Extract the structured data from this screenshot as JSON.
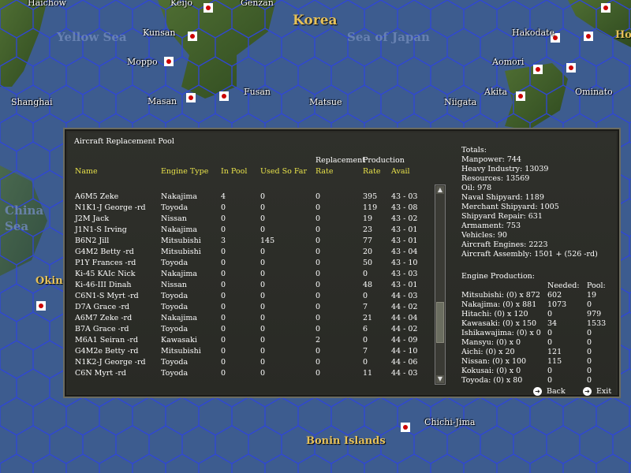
{
  "map": {
    "labels": [
      {
        "name": "map-label-haichow",
        "text": "Haichow"
      },
      {
        "name": "map-label-keijo",
        "text": "Keijo"
      },
      {
        "name": "map-label-genzan",
        "text": "Genzan"
      },
      {
        "name": "map-label-kunsan",
        "text": "Kunsan"
      },
      {
        "name": "map-label-moppo",
        "text": "Moppo"
      },
      {
        "name": "map-label-masan",
        "text": "Masan"
      },
      {
        "name": "map-label-fusan",
        "text": "Fusan"
      },
      {
        "name": "map-label-matsue",
        "text": "Matsue"
      },
      {
        "name": "map-label-niigata",
        "text": "Niigata"
      },
      {
        "name": "map-label-akita",
        "text": "Akita"
      },
      {
        "name": "map-label-aomori",
        "text": "Aomori"
      },
      {
        "name": "map-label-hakodate",
        "text": "Hakodate"
      },
      {
        "name": "map-label-ominato",
        "text": "Ominato"
      },
      {
        "name": "map-label-shanghai",
        "text": "Shanghai"
      },
      {
        "name": "map-label-chichi-jima",
        "text": "Chichi-Jima"
      }
    ],
    "seas": {
      "yellow_sea": "Yellow Sea",
      "sea_of_japan": "Sea of Japan",
      "china_sea_1": "China",
      "china_sea_2": "Sea"
    },
    "regions": {
      "korea": "Korea",
      "bonin": "Bonin Islands",
      "okin": "Okin",
      "ho": "Ho"
    }
  },
  "panel": {
    "title": "Aircraft Replacement Pool",
    "headers": {
      "name": "Name",
      "engine_type": "Engine Type",
      "in_pool": "In Pool",
      "used_so_far": "Used So Far",
      "replacement_top": "Replacement",
      "replacement_bottom": "Rate",
      "production_top": "Production",
      "production_bottom": "Rate",
      "avail": "Avail"
    },
    "rows": [
      {
        "name": "A6M5 Zeke",
        "engine": "Nakajima",
        "in_pool": "4",
        "used": "0",
        "repl": "0",
        "prod": "395",
        "avail": "43 - 03"
      },
      {
        "name": "N1K1-J George -rd",
        "engine": "Toyoda",
        "in_pool": "0",
        "used": "0",
        "repl": "0",
        "prod": "119",
        "avail": "43 - 08"
      },
      {
        "name": "J2M Jack",
        "engine": "Nissan",
        "in_pool": "0",
        "used": "0",
        "repl": "0",
        "prod": "19",
        "avail": "43 - 02"
      },
      {
        "name": "J1N1-S Irving",
        "engine": "Nakajima",
        "in_pool": "0",
        "used": "0",
        "repl": "0",
        "prod": "23",
        "avail": "43 - 01"
      },
      {
        "name": "B6N2 Jill",
        "engine": "Mitsubishi",
        "in_pool": "3",
        "used": "145",
        "repl": "0",
        "prod": "77",
        "avail": "43 - 01"
      },
      {
        "name": "G4M2 Betty -rd",
        "engine": "Mitsubishi",
        "in_pool": "0",
        "used": "0",
        "repl": "0",
        "prod": "20",
        "avail": "43 - 04"
      },
      {
        "name": "P1Y Frances -rd",
        "engine": "Toyoda",
        "in_pool": "0",
        "used": "0",
        "repl": "0",
        "prod": "50",
        "avail": "43 - 10"
      },
      {
        "name": "Ki-45 KAIc Nick",
        "engine": "Nakajima",
        "in_pool": "0",
        "used": "0",
        "repl": "0",
        "prod": "0",
        "avail": "43 - 03"
      },
      {
        "name": "Ki-46-III Dinah",
        "engine": "Nissan",
        "in_pool": "0",
        "used": "0",
        "repl": "0",
        "prod": "48",
        "avail": "43 - 01"
      },
      {
        "name": "C6N1-S Myrt -rd",
        "engine": "Toyoda",
        "in_pool": "0",
        "used": "0",
        "repl": "0",
        "prod": "0",
        "avail": "44 - 03"
      },
      {
        "name": "D7A Grace -rd",
        "engine": "Toyoda",
        "in_pool": "0",
        "used": "0",
        "repl": "0",
        "prod": "7",
        "avail": "44 - 02"
      },
      {
        "name": "A6M7 Zeke -rd",
        "engine": "Nakajima",
        "in_pool": "0",
        "used": "0",
        "repl": "0",
        "prod": "21",
        "avail": "44 - 04"
      },
      {
        "name": "B7A Grace -rd",
        "engine": "Toyoda",
        "in_pool": "0",
        "used": "0",
        "repl": "0",
        "prod": "6",
        "avail": "44 - 02"
      },
      {
        "name": "M6A1 Seiran -rd",
        "engine": "Kawasaki",
        "in_pool": "0",
        "used": "0",
        "repl": "2",
        "prod": "0",
        "avail": "44 - 09"
      },
      {
        "name": "G4M2e Betty -rd",
        "engine": "Mitsubishi",
        "in_pool": "0",
        "used": "0",
        "repl": "0",
        "prod": "7",
        "avail": "44 - 10"
      },
      {
        "name": "N1K2-J George -rd",
        "engine": "Toyoda",
        "in_pool": "0",
        "used": "0",
        "repl": "0",
        "prod": "0",
        "avail": "44 - 06"
      },
      {
        "name": "C6N Myrt -rd",
        "engine": "Toyoda",
        "in_pool": "0",
        "used": "0",
        "repl": "0",
        "prod": "11",
        "avail": "44 - 03"
      }
    ],
    "totals": {
      "heading": "Totals:",
      "lines": [
        "Manpower: 744",
        "Heavy Industry: 13039",
        "Resources: 13569",
        "Oil: 978",
        "Naval Shipyard: 1189",
        "Merchant Shipyard: 1005",
        "Shipyard Repair: 631",
        "Armament: 753",
        "Vehicles: 90",
        "Aircraft Engines: 2223",
        "Aircraft Assembly: 1501 + (526 -rd)"
      ]
    },
    "engine_production": {
      "heading": "Engine Production:",
      "needed_label": "Needed:",
      "pool_label": "Pool:",
      "rows": [
        {
          "label": "Mitsubishi:  (0) x 872",
          "needed": "602",
          "pool": "19"
        },
        {
          "label": "Nakajima:  (0) x 881",
          "needed": "1073",
          "pool": "0"
        },
        {
          "label": "Hitachi:  (0) x 120",
          "needed": "0",
          "pool": "979"
        },
        {
          "label": "Kawasaki:  (0) x 150",
          "needed": "34",
          "pool": "1533"
        },
        {
          "label": "Ishikawajima:  (0) x 0",
          "needed": "0",
          "pool": "0"
        },
        {
          "label": "Mansyu:  (0) x 0",
          "needed": "0",
          "pool": "0"
        },
        {
          "label": "Aichi:  (0) x 20",
          "needed": "121",
          "pool": "0"
        },
        {
          "label": "Nissan:  (0) x 100",
          "needed": "115",
          "pool": "0"
        },
        {
          "label": "Kokusai:  (0) x 0",
          "needed": "0",
          "pool": "0"
        },
        {
          "label": "Toyoda:  (0) x 80",
          "needed": "0",
          "pool": "0"
        }
      ]
    },
    "buttons": {
      "back": "Back",
      "exit": "Exit"
    }
  }
}
